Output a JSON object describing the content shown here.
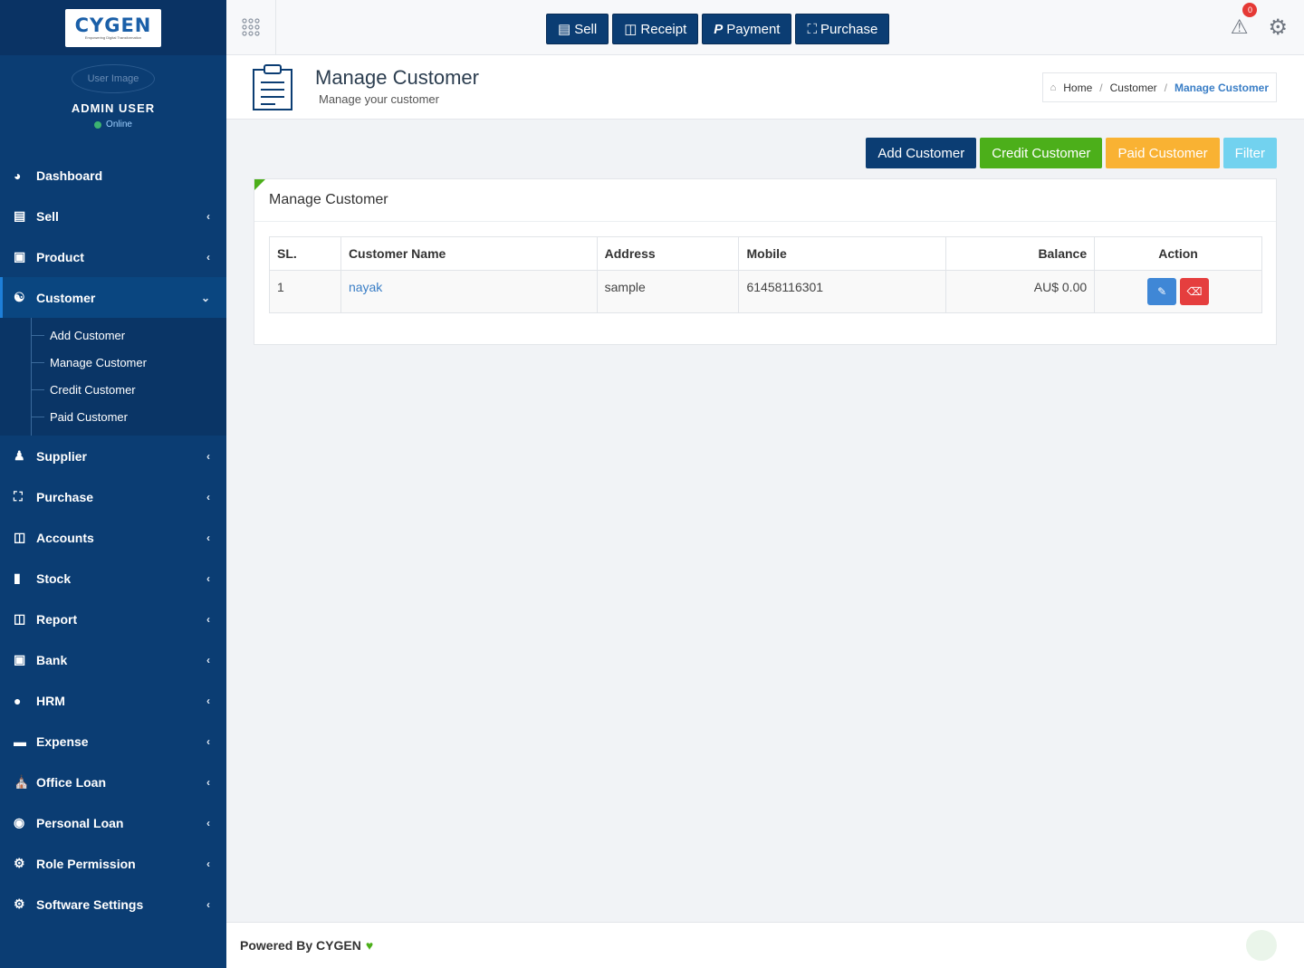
{
  "logo": {
    "text": "CYGEN",
    "tagline": "Empowering Digital Transformation"
  },
  "user": {
    "image_alt": "User Image",
    "name": "ADMIN USER",
    "status": "Online"
  },
  "sidebar": {
    "items": [
      {
        "label": "Dashboard",
        "icon": "dashboard-icon"
      },
      {
        "label": "Sell",
        "icon": "sell-icon"
      },
      {
        "label": "Product",
        "icon": "product-icon"
      },
      {
        "label": "Customer",
        "icon": "customer-icon"
      },
      {
        "label": "Supplier",
        "icon": "supplier-icon"
      },
      {
        "label": "Purchase",
        "icon": "cart-icon"
      },
      {
        "label": "Accounts",
        "icon": "accounts-icon"
      },
      {
        "label": "Stock",
        "icon": "stock-icon"
      },
      {
        "label": "Report",
        "icon": "report-icon"
      },
      {
        "label": "Bank",
        "icon": "bank-icon"
      },
      {
        "label": "HRM",
        "icon": "person-icon"
      },
      {
        "label": "Expense",
        "icon": "card-icon"
      },
      {
        "label": "Office Loan",
        "icon": "institution-icon"
      },
      {
        "label": "Personal Loan",
        "icon": "user-circle-icon"
      },
      {
        "label": "Role Permission",
        "icon": "gear-icon"
      },
      {
        "label": "Software Settings",
        "icon": "gear-icon"
      }
    ],
    "customer_sub": [
      "Add Customer",
      "Manage Customer",
      "Credit Customer",
      "Paid Customer"
    ]
  },
  "topbar": {
    "buttons": [
      "Sell",
      "Receipt",
      "Payment",
      "Purchase"
    ],
    "notification_count": "0"
  },
  "page": {
    "title": "Manage Customer",
    "subtitle": "Manage your customer"
  },
  "breadcrumb": [
    "Home",
    "Customer",
    "Manage Customer"
  ],
  "actions": [
    "Add Customer",
    "Credit Customer",
    "Paid Customer",
    "Filter"
  ],
  "card": {
    "title": "Manage Customer"
  },
  "table": {
    "headers": [
      "SL.",
      "Customer Name",
      "Address",
      "Mobile",
      "Balance",
      "Action"
    ],
    "rows": [
      {
        "sl": "1",
        "name": "nayak",
        "address": "sample",
        "mobile": "61458116301",
        "balance": "AU$ 0.00"
      }
    ]
  },
  "footer": {
    "text": "Powered By CYGEN"
  },
  "colors": {
    "sidebar": "#0b3d73",
    "green": "#4caf1a",
    "orange": "#f9b233",
    "cyan": "#72d2ef",
    "link": "#3a7ec6",
    "danger": "#e53e3e"
  }
}
